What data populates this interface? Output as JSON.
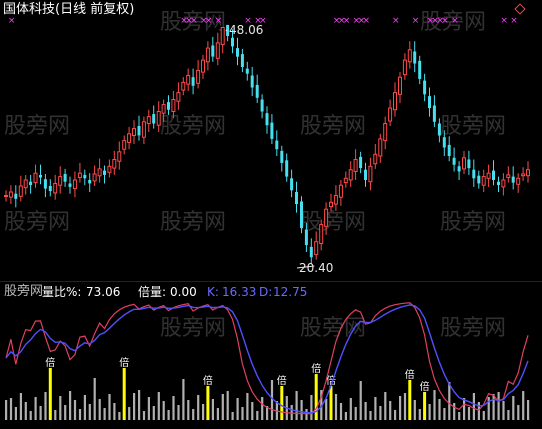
{
  "window": {
    "title": "国体科技(日线 前复权)"
  },
  "chart_data": [
    {
      "type": "candlestick",
      "title": "国体科技(日线 前复权)",
      "price_labels": {
        "high": "48.06",
        "low": "20.40"
      },
      "high": 48.06,
      "low": 20.4,
      "closes": [
        28.4,
        28.8,
        28.0,
        29.5,
        30.2,
        29.6,
        31.0,
        30.5,
        29.2,
        28.9,
        29.8,
        30.6,
        30.0,
        29.4,
        30.2,
        31.0,
        30.4,
        29.8,
        30.9,
        31.5,
        30.8,
        31.8,
        32.6,
        33.5,
        34.8,
        35.6,
        36.2,
        35.4,
        37.0,
        37.6,
        36.8,
        38.2,
        39.0,
        38.4,
        39.6,
        40.4,
        41.6,
        42.4,
        41.2,
        43.0,
        44.2,
        45.6,
        44.6,
        46.2,
        48.0,
        47.0,
        45.8,
        44.6,
        43.4,
        42.6,
        41.0,
        39.8,
        38.2,
        36.6,
        35.0,
        33.8,
        32.2,
        30.6,
        29.0,
        27.4,
        24.6,
        22.6,
        21.2,
        23.0,
        25.0,
        26.8,
        27.6,
        28.4,
        29.6,
        30.4,
        31.4,
        32.6,
        31.6,
        30.2,
        31.8,
        33.2,
        35.0,
        36.8,
        38.6,
        40.4,
        42.2,
        44.2,
        45.4,
        43.8,
        42.0,
        40.2,
        38.6,
        37.0,
        35.4,
        34.0,
        33.0,
        32.0,
        31.2,
        32.8,
        31.6,
        30.4,
        29.8,
        30.6,
        31.0,
        30.2,
        29.6,
        30.2,
        30.8,
        29.9,
        30.4,
        30.9,
        31.4
      ],
      "volume_ratio_label": "量比%:",
      "volume_ratio": "73.06",
      "multiple_label": "倍量:",
      "multiple": "0.00",
      "k_label": "K:",
      "k": "16.33",
      "d_label": "D:",
      "d": "12.75",
      "marker_text": "倍",
      "colors": {
        "up": "#ff4a4a",
        "down": "#46e0f0",
        "k_line": "#e04060",
        "d_line": "#5050ff",
        "marker": "#ffff00",
        "volume": "#b0b0b0",
        "signal": "#ff40ff"
      }
    }
  ],
  "watermark": "股旁网"
}
